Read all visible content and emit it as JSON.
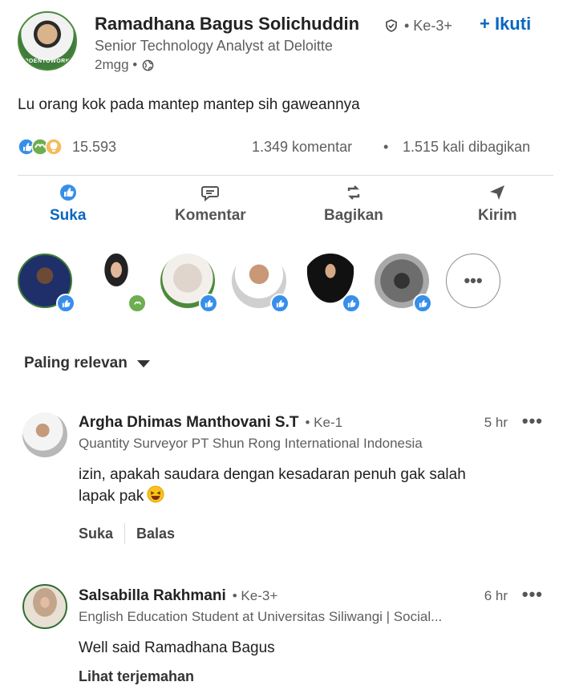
{
  "post": {
    "author_name": "Ramadhana Bagus Solichuddin",
    "author_degree": "• Ke-3+",
    "follow_label": "+ Ikuti",
    "author_headline": "Senior Technology Analyst at Deloitte",
    "time": "2mgg •",
    "avatar_ring_text": "POENTOWORK",
    "text": "Lu orang kok pada mantep mantep sih gaweannya"
  },
  "stats": {
    "reactions": "15.593",
    "comments": "1.349 komentar",
    "dot": "•",
    "shares": "1.515 kali dibagikan"
  },
  "actions": [
    {
      "label": "Suka",
      "icon": "like-icon",
      "active": true
    },
    {
      "label": "Komentar",
      "icon": "comment-icon",
      "active": false
    },
    {
      "label": "Bagikan",
      "icon": "repost-icon",
      "active": false
    },
    {
      "label": "Kirim",
      "icon": "send-icon",
      "active": false
    }
  ],
  "reactors_more_label": "•••",
  "sort": {
    "label": "Paling relevan"
  },
  "comments": [
    {
      "name": "Argha Dhimas Manthovani S.T",
      "degree": "• Ke-1",
      "time": "5 hr",
      "more": "•••",
      "headline": "Quantity Surveyor PT Shun Rong International Indonesia",
      "body_line1": "izin, apakah saudara dengan kesadaran penuh gak salah",
      "body_line2": "lapak pak",
      "emoji": "laughing-face-icon",
      "like_label": "Suka",
      "reply_label": "Balas"
    },
    {
      "name": "Salsabilla Rakhmani",
      "degree": "• Ke-3+",
      "time": "6 hr",
      "more": "•••",
      "headline": "English Education Student at Universitas Siliwangi | Social...",
      "body_line1": "Well said Ramadhana Bagus",
      "translate_label": "Lihat terjemahan"
    }
  ],
  "colors": {
    "brand_blue": "#0a66c2",
    "like_badge": "#378fe9",
    "muted_text": "#5e5e5e"
  }
}
